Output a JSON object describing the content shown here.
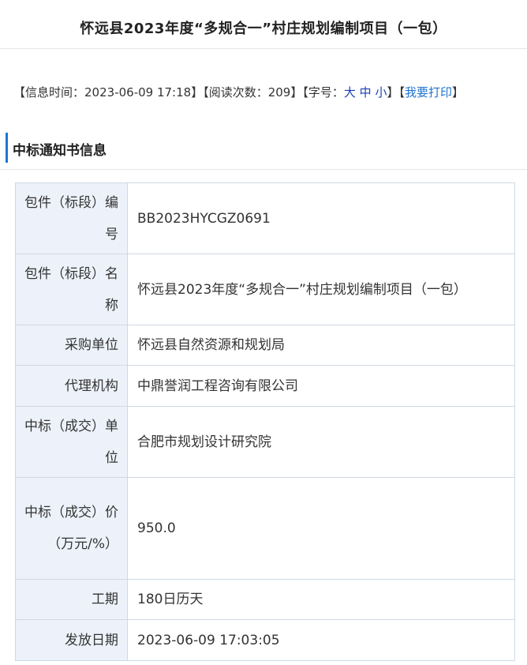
{
  "header": {
    "title": "怀远县2023年度“多规合一”村庄规划编制项目（一包）"
  },
  "meta": {
    "info_time_prefix": "【信息时间：",
    "info_time": "2023-06-09 17:18",
    "sep1": "】【阅读次数：",
    "read_count": "209",
    "sep2": "】【字号：",
    "font_large": "大",
    "font_medium": "中",
    "font_small": "小",
    "sep3": "】【",
    "print_label": "我要打印",
    "close": "】"
  },
  "section": {
    "title": "中标通知书信息"
  },
  "rows": [
    {
      "label": "包件（标段）编号",
      "value": "BB2023HYCGZ0691"
    },
    {
      "label": "包件（标段）名称",
      "value": "怀远县2023年度“多规合一”村庄规划编制项目（一包）"
    },
    {
      "label": "采购单位",
      "value": "怀远县自然资源和规划局"
    },
    {
      "label": "代理机构",
      "value": "中鼎誉润工程咨询有限公司"
    },
    {
      "label": "中标（成交）单位",
      "value": "合肥市规划设计研究院"
    },
    {
      "label": "中标（成交）价（万元/%）",
      "value": "950.0"
    },
    {
      "label": "工期",
      "value": "180日历天"
    },
    {
      "label": "发放日期",
      "value": "2023-06-09 17:03:05"
    }
  ]
}
